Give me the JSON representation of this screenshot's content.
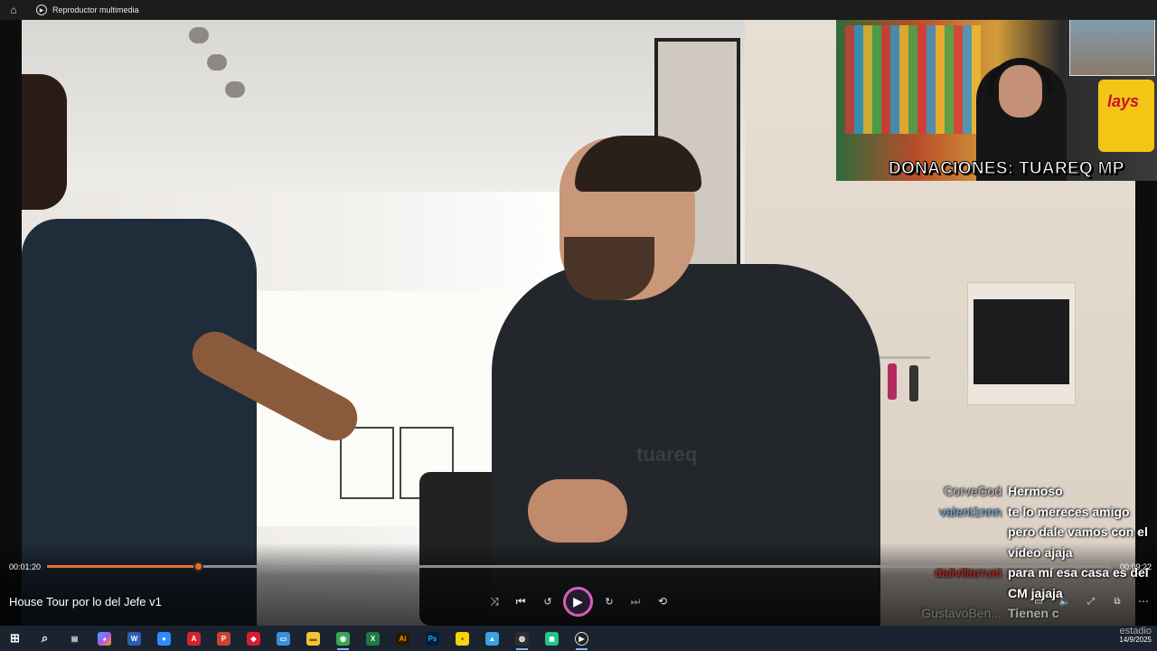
{
  "window": {
    "title": "Reproductor multimedia"
  },
  "webcam": {
    "donation_text": "DONACIONES: TUAREQ MP",
    "brand": "lays"
  },
  "video": {
    "shirt_logo": "tuareq"
  },
  "chat": [
    {
      "user": "CorveGod",
      "color": "#b8b8b8",
      "message": "Hermoso"
    },
    {
      "user": "valent1nnn",
      "color": "#6fa8dc",
      "message": "te lo mereces amigo pero dale vamos con el video ajaja"
    },
    {
      "user": "dailvillarruel",
      "color": "#c0201f",
      "message": "para mí esa casa es del CM jajaja"
    },
    {
      "user": "GustavoBen...",
      "color": "#9aa0a0",
      "message": "Tienen c",
      "faded": true
    }
  ],
  "player": {
    "current_time": "00:01:20",
    "duration": "00:09:22",
    "progress_fraction": 0.1423,
    "video_title": "House Tour por lo del Jefe v1",
    "accent_color": "#e0702e"
  },
  "taskbar": {
    "apps": [
      "start",
      "search",
      "task-view",
      "copilot",
      "word",
      "zoom",
      "acrobat",
      "powerpoint",
      "app-red",
      "remote",
      "file-explorer",
      "chrome",
      "excel",
      "illustrator",
      "photoshop",
      "sticky-notes",
      "paint",
      "obs",
      "green-app",
      "media-player"
    ],
    "tray_text": "estadio",
    "date": "14/9/2025"
  }
}
